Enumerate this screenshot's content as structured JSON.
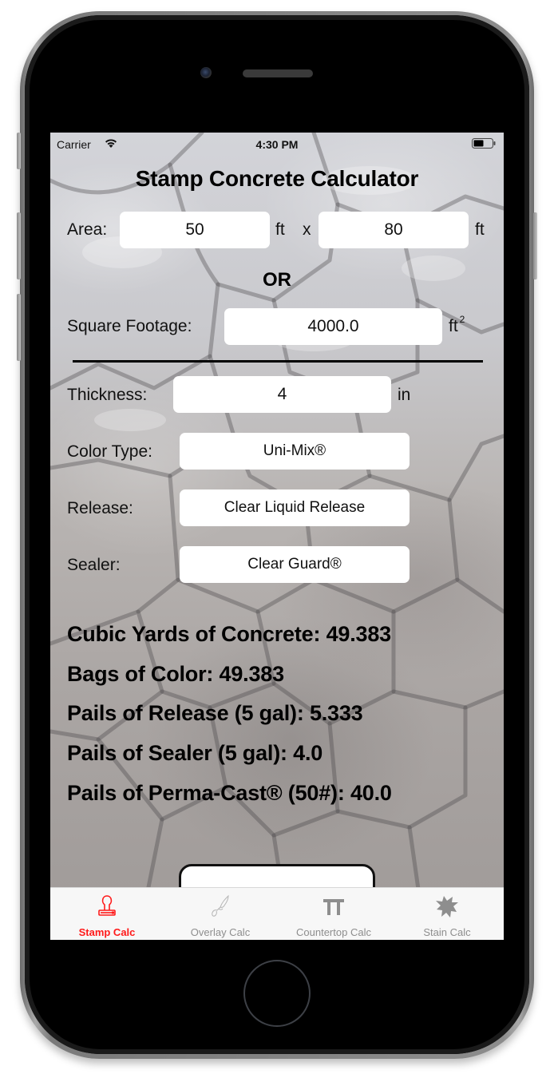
{
  "status_bar": {
    "carrier": "Carrier",
    "time": "4:30 PM",
    "wifi_icon": "wifi-icon",
    "battery_icon": "battery-icon"
  },
  "title": "Stamp Concrete Calculator",
  "area": {
    "label": "Area:",
    "length_value": "50",
    "length_unit": "ft",
    "times": "x",
    "width_value": "80",
    "width_unit": "ft"
  },
  "or_label": "OR",
  "square_footage": {
    "label": "Square Footage:",
    "value": "4000.0",
    "unit": "ft",
    "unit_exponent": "2"
  },
  "thickness": {
    "label": "Thickness:",
    "value": "4",
    "unit": "in"
  },
  "color_type": {
    "label": "Color Type:",
    "selected": "Uni-Mix®"
  },
  "release": {
    "label": "Release:",
    "selected": "Clear Liquid Release"
  },
  "sealer": {
    "label": "Sealer:",
    "selected": "Clear Guard®"
  },
  "results": [
    {
      "label": "Cubic Yards of Concrete:",
      "value": "49.383"
    },
    {
      "label": "Bags of Color:",
      "value": "49.383"
    },
    {
      "label": "Pails of Release (5 gal):",
      "value": "5.333"
    },
    {
      "label": "Pails of Sealer (5 gal):",
      "value": "4.0"
    },
    {
      "label": "Pails of Perma-Cast® (50#):",
      "value": "40.0"
    }
  ],
  "tab_bar": {
    "active_color": "#ff1a1a",
    "inactive_color": "#8e8e8e",
    "tabs": [
      {
        "label": "Stamp Calc",
        "icon": "stamp-icon",
        "active": true
      },
      {
        "label": "Overlay Calc",
        "icon": "trowel-icon",
        "active": false
      },
      {
        "label": "Countertop Calc",
        "icon": "countertop-icon",
        "active": false
      },
      {
        "label": "Stain Calc",
        "icon": "stain-splat-icon",
        "active": false
      }
    ]
  }
}
